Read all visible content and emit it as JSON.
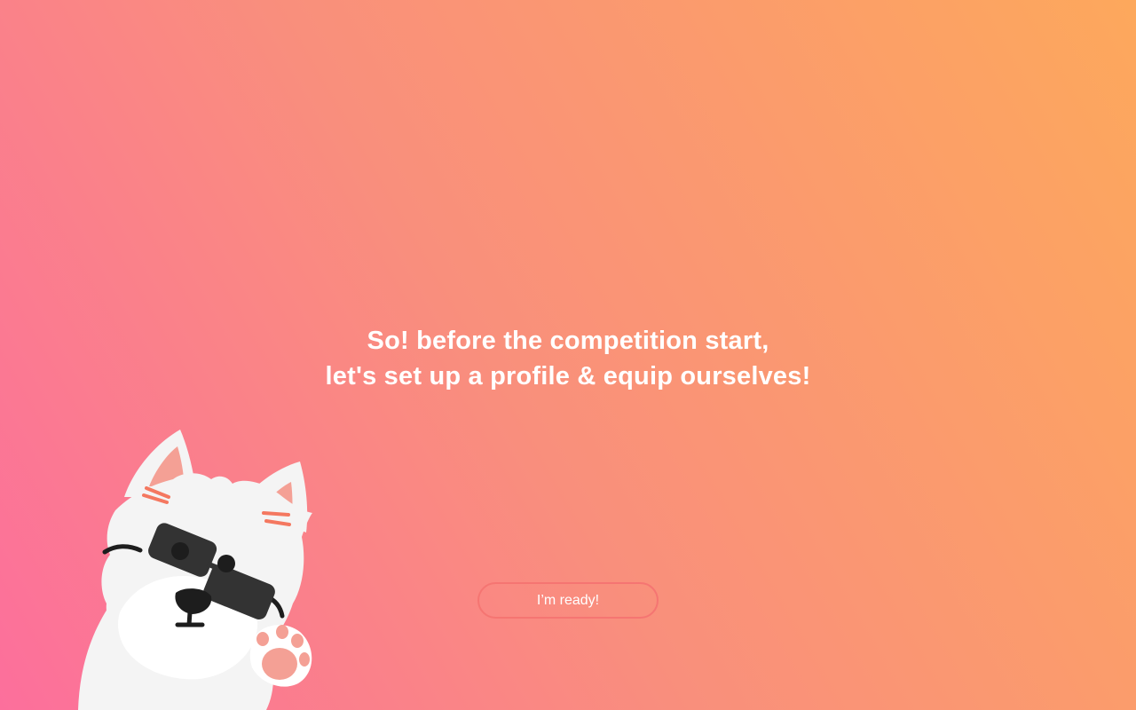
{
  "intro": {
    "line1": "So! before the competition start,",
    "line2": "let's set up a profile & equip ourselves!"
  },
  "ready_button": {
    "label": "I’m ready!"
  },
  "colors": {
    "gradient_start": "#fc6f9c",
    "gradient_mid": "#f98f7c",
    "gradient_end": "#fda85c",
    "button_border": "#f57572",
    "text": "#ffffff"
  },
  "mascot": {
    "icon": "dog-with-sunglasses-icon"
  }
}
